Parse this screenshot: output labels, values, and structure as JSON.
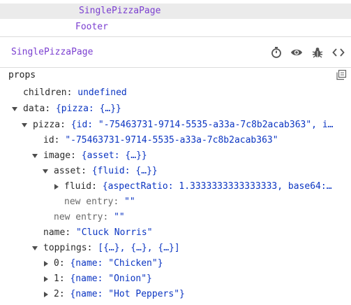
{
  "tree": {
    "selected_label": "SinglePizzaPage",
    "footer_label": "Footer"
  },
  "inspector": {
    "component_name": "SinglePizzaPage",
    "icons": [
      "stopwatch-icon",
      "eye-icon",
      "bug-icon",
      "code-icon"
    ]
  },
  "props": {
    "title": "props",
    "rows": {
      "children": {
        "key": "children",
        "value": "undefined"
      },
      "data": {
        "key": "data",
        "value": "{pizza: {…}}"
      },
      "pizza": {
        "key": "pizza",
        "value": "{id: \"-75463731-9714-5535-a33a-7c8b2acab363\", i…"
      },
      "id": {
        "key": "id",
        "value": "\"-75463731-9714-5535-a33a-7c8b2acab363\""
      },
      "image": {
        "key": "image",
        "value": "{asset: {…}}"
      },
      "asset": {
        "key": "asset",
        "value": "{fluid: {…}}"
      },
      "fluid": {
        "key": "fluid",
        "value": "{aspectRatio: 1.3333333333333333, base64:…"
      },
      "new_entry_1": {
        "key": "new entry",
        "value": "\"\""
      },
      "new_entry_2": {
        "key": "new entry",
        "value": "\"\""
      },
      "name": {
        "key": "name",
        "value": "\"Cluck Norris\""
      },
      "toppings": {
        "key": "toppings",
        "value": "[{…}, {…}, {…}]"
      },
      "topping_0": {
        "key": "0",
        "value": "{name: \"Chicken\"}"
      },
      "topping_1": {
        "key": "1",
        "value": "{name: \"Onion\"}"
      },
      "topping_2": {
        "key": "2",
        "value": "{name: \"Hot Peppers\"}"
      }
    }
  }
}
